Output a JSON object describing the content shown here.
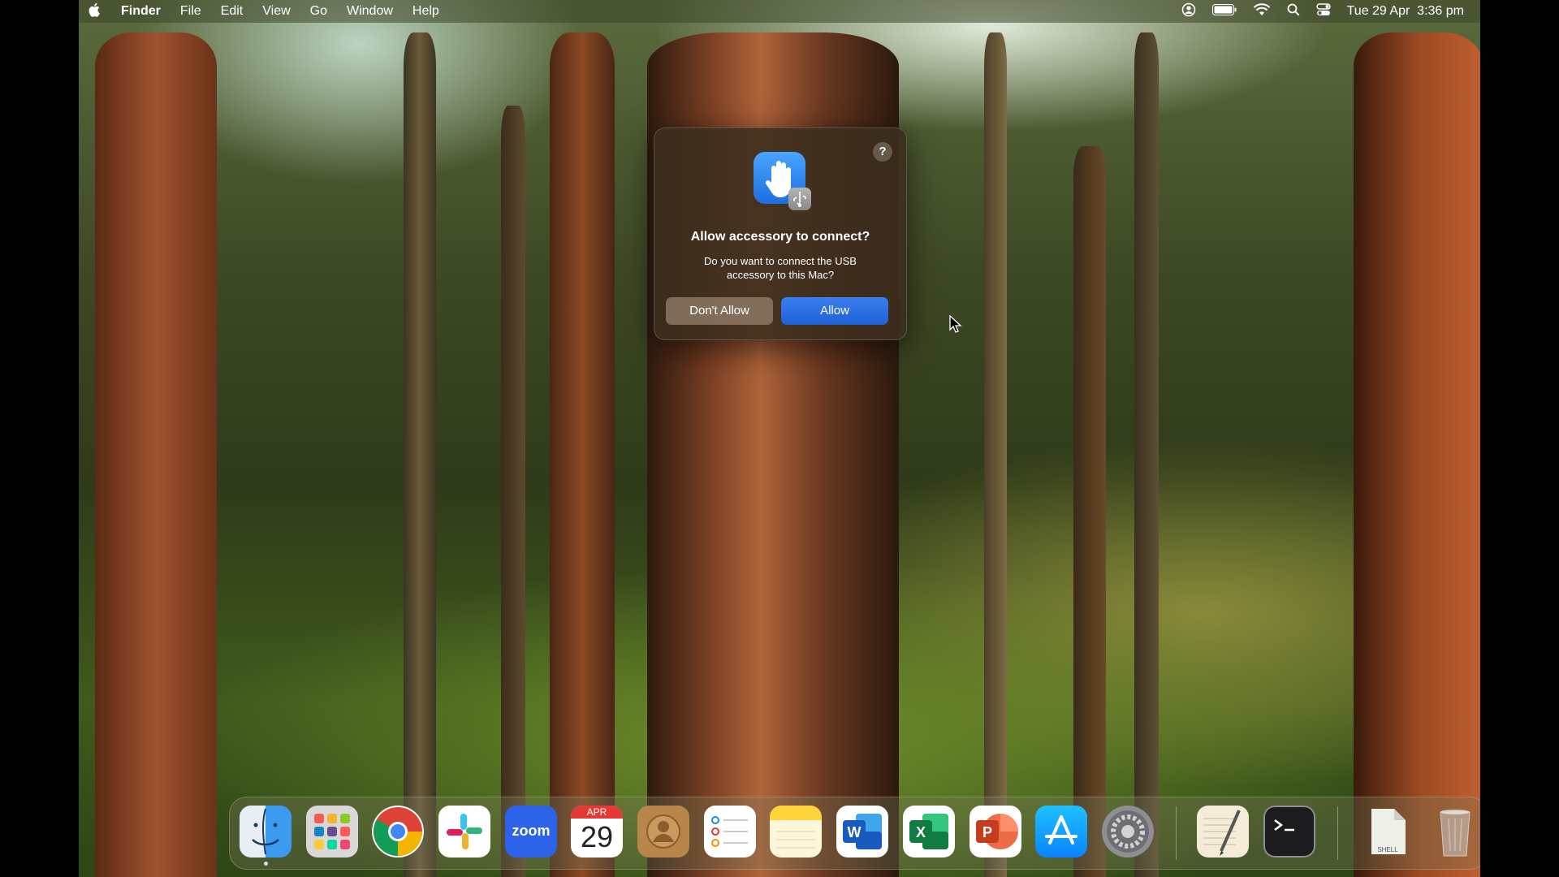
{
  "menubar": {
    "app_name": "Finder",
    "menus": [
      "File",
      "Edit",
      "View",
      "Go",
      "Window",
      "Help"
    ],
    "status_icons": [
      "user-icon",
      "battery-icon",
      "wifi-icon",
      "search-icon",
      "control-center-icon"
    ],
    "clock": "Tue 29 Apr  3:36 pm"
  },
  "dialog": {
    "help_label": "?",
    "title": "Allow accessory to connect?",
    "message": "Do you want to connect the USB accessory to this Mac?",
    "deny_label": "Don't Allow",
    "allow_label": "Allow",
    "icon": "hand-usb-icon"
  },
  "dock": {
    "calendar_month": "APR",
    "calendar_day": "29",
    "zoom_label": "zoom",
    "shell_label": "SHELL",
    "apps": [
      "Finder",
      "Launchpad",
      "Chrome",
      "Slack",
      "Zoom",
      "Calendar",
      "Contacts",
      "Reminders",
      "Notes",
      "Word",
      "Excel",
      "PowerPoint",
      "App Store",
      "System Settings",
      "TextEdit",
      "Terminal"
    ]
  },
  "colors": {
    "accent": "#1f62d6",
    "dialog_bg": "#3c2d1e"
  }
}
